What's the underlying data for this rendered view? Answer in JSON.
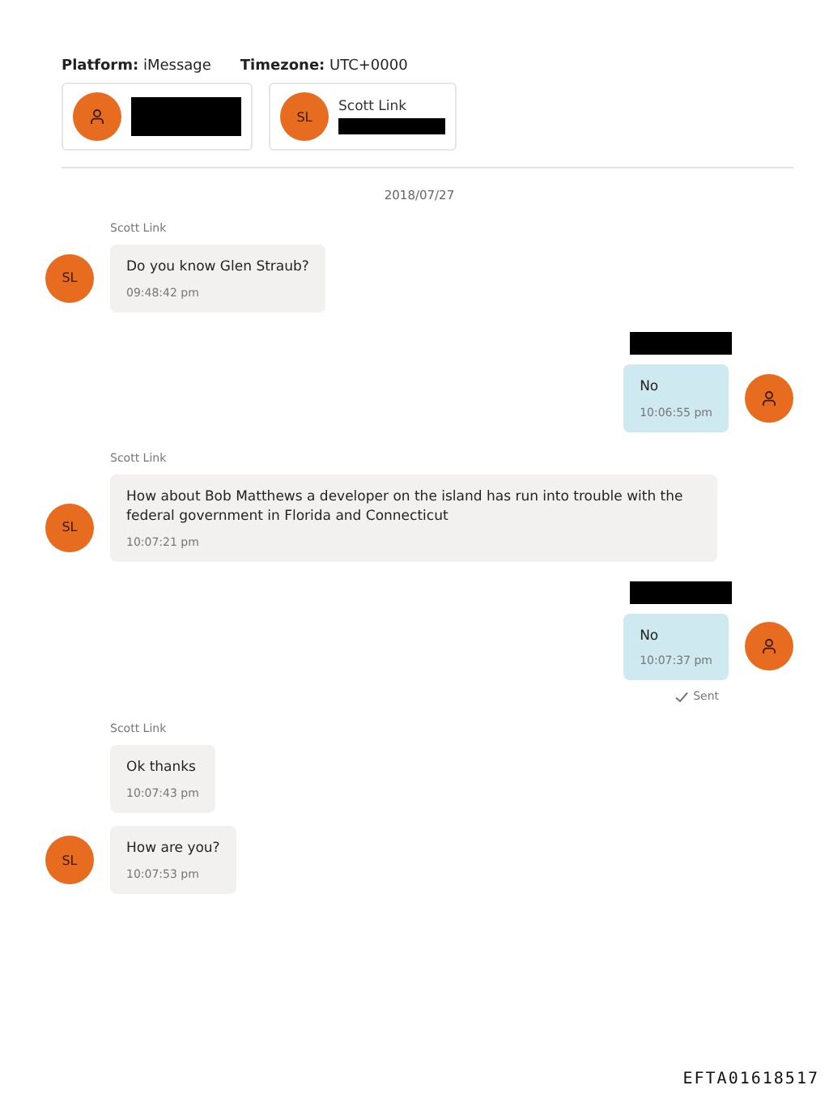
{
  "header": {
    "platform_label": "Platform:",
    "platform": "iMessage",
    "timezone_label": "Timezone:",
    "timezone": "UTC+0000"
  },
  "participants": [
    {
      "avatar": {
        "kind": "icon"
      },
      "redacted": true
    },
    {
      "avatar": {
        "kind": "initials",
        "text": "SL"
      },
      "name": "Scott Link",
      "redacted": true
    }
  ],
  "date": "2018/07/27",
  "groups": [
    {
      "kind": "incoming",
      "sender": "Scott Link",
      "avatar": {
        "kind": "initials",
        "text": "SL"
      },
      "messages": [
        {
          "text": "Do you know Glen Straub?",
          "time": "09:48:42 pm"
        }
      ]
    },
    {
      "kind": "outgoing",
      "sender_redacted": true,
      "avatar": {
        "kind": "icon"
      },
      "messages": [
        {
          "text": "No",
          "time": "10:06:55 pm"
        }
      ]
    },
    {
      "kind": "incoming",
      "sender": "Scott Link",
      "avatar": {
        "kind": "initials",
        "text": "SL"
      },
      "messages": [
        {
          "text": "How about Bob Matthews a developer on the island has run into trouble with the federal government in Florida and Connecticut",
          "time": "10:07:21 pm"
        }
      ]
    },
    {
      "kind": "outgoing",
      "sender_redacted": true,
      "avatar": {
        "kind": "icon"
      },
      "messages": [
        {
          "text": "No",
          "time": "10:07:37 pm"
        }
      ],
      "status": "Sent"
    },
    {
      "kind": "incoming",
      "sender": "Scott Link",
      "avatar": {
        "kind": "initials",
        "text": "SL"
      },
      "messages": [
        {
          "text": "Ok thanks",
          "time": "10:07:43 pm"
        },
        {
          "text": "How are you?",
          "time": "10:07:53 pm"
        }
      ]
    }
  ],
  "stamp": "EFTA01618517"
}
